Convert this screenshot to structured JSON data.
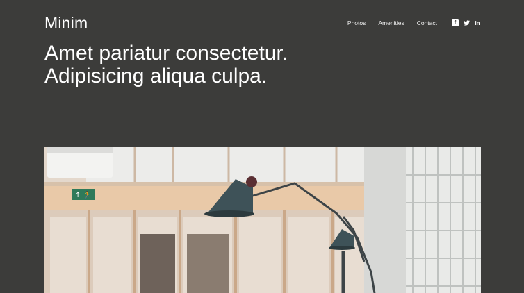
{
  "brand": {
    "name": "Minim"
  },
  "nav": {
    "items": [
      {
        "label": "Photos"
      },
      {
        "label": "Amenities"
      },
      {
        "label": "Contact"
      }
    ],
    "social": [
      {
        "icon": "facebook-icon",
        "glyph": "f"
      },
      {
        "icon": "twitter-icon",
        "glyph": "🐦"
      },
      {
        "icon": "linkedin-icon",
        "glyph": "in"
      }
    ]
  },
  "hero": {
    "line1": "Amet pariatur consectetur.",
    "line2": "Adipisicing aliqua culpa."
  },
  "photo": {
    "subject": "interior-with-floor-lamp",
    "exit_sign": "↑ 🏃"
  },
  "colors": {
    "background": "#3c3c3a",
    "text": "#ffffff"
  }
}
